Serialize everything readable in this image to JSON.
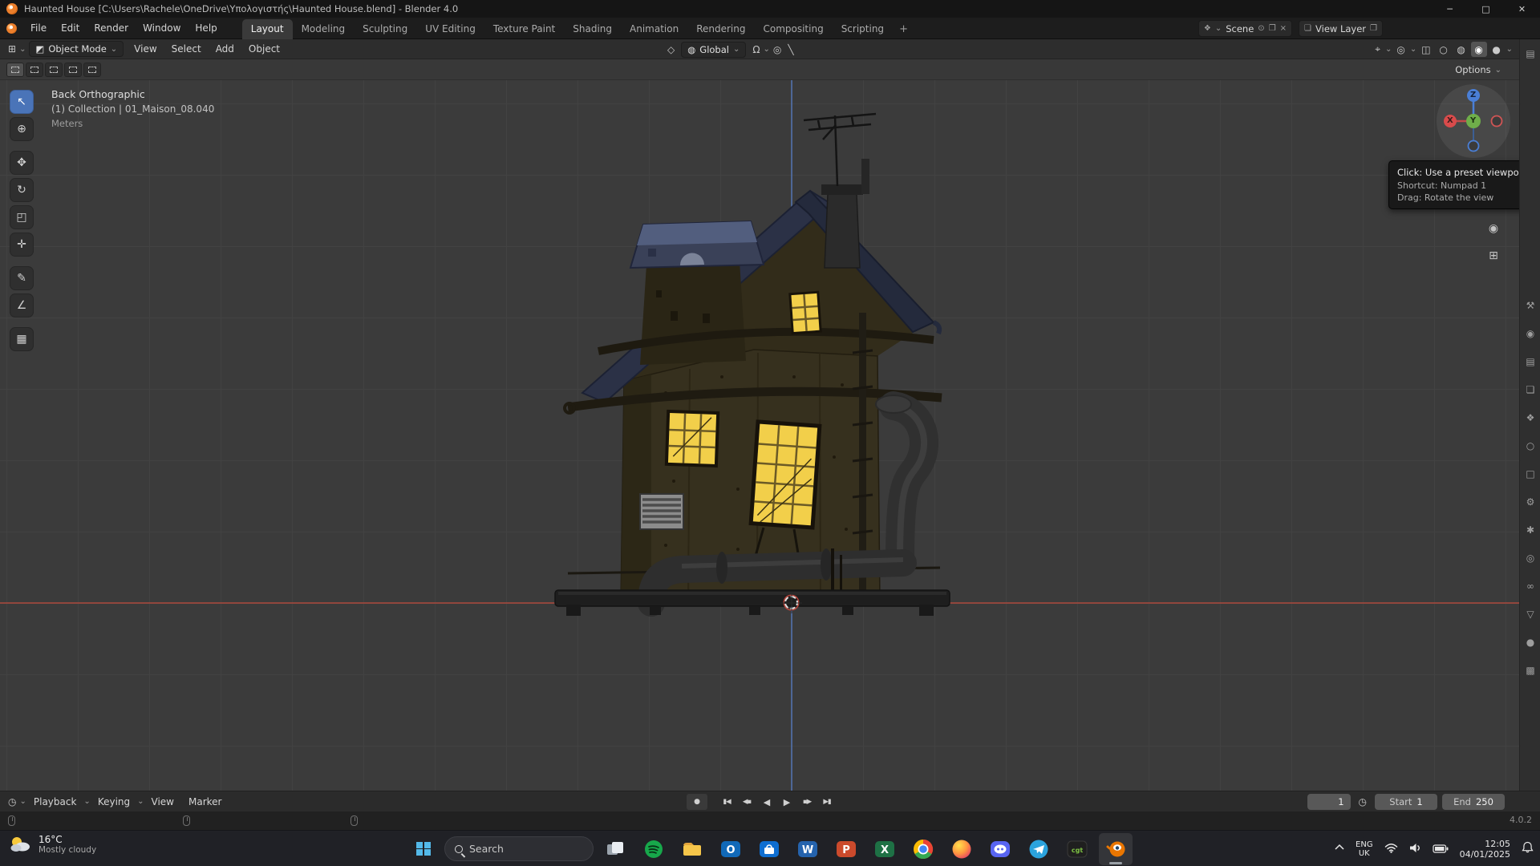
{
  "titlebar": {
    "title": "Haunted House [C:\\Users\\Rachele\\OneDrive\\Υπολογιστής\\Haunted House.blend] - Blender 4.0"
  },
  "glyphs": {
    "win_min": "─",
    "win_max": "□",
    "win_close": "✕",
    "caret": "⌄",
    "plus": "+",
    "editor_type": "⊞",
    "object_mode_icon": "◩",
    "pivot": "◇",
    "orientation_icon": "◍",
    "magnet": "Ω",
    "proportional": "◎",
    "falloff": "╲",
    "gizmo_toggle": "⌖",
    "overlays": "◎",
    "xray": "◫",
    "shade_wire": "○",
    "shade_solid": "◍",
    "shade_material": "◉",
    "shade_render": "●",
    "scene_icon": "❖",
    "view_layer_icon": "❏",
    "pin": "⊙",
    "copy": "❐",
    "close_x": "×",
    "record": "●",
    "jump_start": "▮◀",
    "prev_key": "◀▪",
    "play_rev": "◀",
    "play": "▶",
    "next_key": "▪▶",
    "jump_end": "▶▮",
    "clock": "◷",
    "zoom": "⊕",
    "pan": "✥",
    "camera": "◉",
    "grid": "⊞",
    "props_editor": "▤"
  },
  "topbar": {
    "menus": [
      "File",
      "Edit",
      "Render",
      "Window",
      "Help"
    ],
    "workspaces": [
      "Layout",
      "Modeling",
      "Sculpting",
      "UV Editing",
      "Texture Paint",
      "Shading",
      "Animation",
      "Rendering",
      "Compositing",
      "Scripting"
    ],
    "active_workspace": "Layout",
    "scene_label": "Scene",
    "view_layer_label": "View Layer"
  },
  "viewport_header": {
    "mode": "Object Mode",
    "menus": [
      "View",
      "Select",
      "Add",
      "Object"
    ],
    "orientation": "Global",
    "options": "Options"
  },
  "viewport": {
    "info_line1": "Back Orthographic",
    "info_line2": "(1) Collection | 01_Maison_08.040",
    "info_line3": "Meters",
    "tooltip": {
      "line1": "Click: Use a preset viewpoint",
      "line2": "Shortcut: Numpad 1",
      "line3": "Drag: Rotate the view"
    },
    "gizmo": {
      "x": "X",
      "y": "Y",
      "z": "Z"
    }
  },
  "toolbar": {
    "tools": [
      {
        "name": "select-box",
        "glyph": "↖",
        "active": true
      },
      {
        "name": "cursor",
        "glyph": "⊕"
      },
      {
        "name": "move",
        "glyph": "✥"
      },
      {
        "name": "rotate",
        "glyph": "↻"
      },
      {
        "name": "scale",
        "glyph": "◰"
      },
      {
        "name": "transform",
        "glyph": "✛"
      },
      {
        "name": "annotate",
        "glyph": "✎"
      },
      {
        "name": "measure",
        "glyph": "∠"
      },
      {
        "name": "add-cube",
        "glyph": "▦"
      }
    ]
  },
  "select_mode_icons": [
    "set",
    "extend",
    "subtract",
    "invert",
    "intersect"
  ],
  "props_tabs": [
    {
      "name": "tool",
      "glyph": "⚒"
    },
    {
      "name": "render",
      "glyph": "◉"
    },
    {
      "name": "output",
      "glyph": "▤"
    },
    {
      "name": "view-layer",
      "glyph": "❏"
    },
    {
      "name": "scene",
      "glyph": "❖"
    },
    {
      "name": "world",
      "glyph": "○"
    },
    {
      "name": "object",
      "glyph": "□"
    },
    {
      "name": "modifiers",
      "glyph": "⚙"
    },
    {
      "name": "particles",
      "glyph": "✱"
    },
    {
      "name": "physics",
      "glyph": "◎"
    },
    {
      "name": "constraints",
      "glyph": "∞"
    },
    {
      "name": "object-data",
      "glyph": "▽"
    },
    {
      "name": "material",
      "glyph": "●"
    },
    {
      "name": "texture",
      "glyph": "▩"
    }
  ],
  "timeline": {
    "menus": [
      "Playback",
      "Keying",
      "View",
      "Marker"
    ],
    "current_frame": "1",
    "start_label": "Start",
    "start_value": "1",
    "end_label": "End",
    "end_value": "250"
  },
  "statusbar": {
    "version": "4.0.2"
  },
  "taskbar": {
    "weather": {
      "temp": "16°C",
      "condition": "Mostly cloudy"
    },
    "search": "Search",
    "apps": [
      "task-view",
      "spotify",
      "file-explorer",
      "outlook",
      "store",
      "word",
      "powerpoint",
      "excel",
      "chrome",
      "firefox",
      "discord",
      "telegram",
      "cgtrader",
      "blender"
    ],
    "tray": {
      "lang_top": "ENG",
      "lang_bottom": "UK",
      "time": "12:05",
      "date": "04/01/2025"
    }
  }
}
